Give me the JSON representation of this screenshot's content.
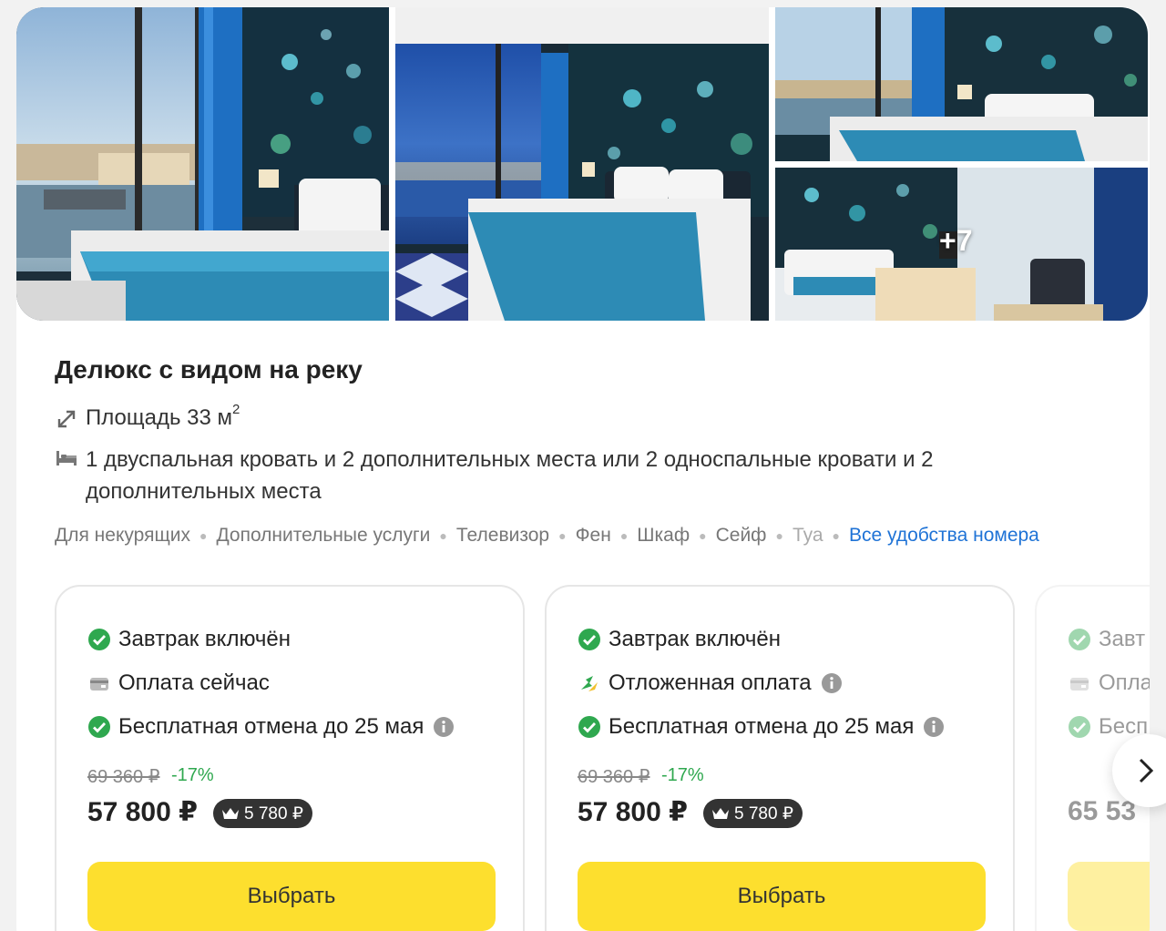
{
  "gallery": {
    "photos": [
      {
        "name": "Deluxe room with river view window"
      },
      {
        "name": "Deluxe room at night view"
      },
      {
        "name": "Deluxe room bed and river"
      },
      {
        "name": "Deluxe room interior with TV"
      }
    ],
    "more_count": "+7"
  },
  "room": {
    "title": "Делюкс с видом на реку",
    "area_label": "Площадь 33 м",
    "area_sup": "2",
    "beds": "1 двуспальная кровать и 2 дополнительных места или 2 односпальные кровати и 2 дополнительных места",
    "amenities": [
      "Для некурящих",
      "Дополнительные услуги",
      "Телевизор",
      "Фен",
      "Шкаф",
      "Сейф"
    ],
    "amenities_faded": "Туа",
    "all_amenities_link": "Все удобства номера"
  },
  "offers": [
    {
      "breakfast": "Завтрак включён",
      "payment": "Оплата сейчас",
      "cancel": "Бесплатная отмена до 25 мая",
      "old_price": "69 360 ₽",
      "discount": "-17%",
      "price": "57 800 ₽",
      "bonus": "5 780 ₽",
      "button": "Выбрать"
    },
    {
      "breakfast": "Завтрак включён",
      "payment": "Отложенная оплата",
      "cancel": "Бесплатная отмена до 25 мая",
      "old_price": "69 360 ₽",
      "discount": "-17%",
      "price": "57 800 ₽",
      "bonus": "5 780 ₽",
      "button": "Выбрать"
    },
    {
      "breakfast": "Завт",
      "payment": "Опла",
      "cancel": "Бесп",
      "price": "65 53"
    }
  ],
  "colors": {
    "accent_yellow": "#fddf2e",
    "link_blue": "#1f73d6",
    "success_green": "#2fa84f"
  }
}
